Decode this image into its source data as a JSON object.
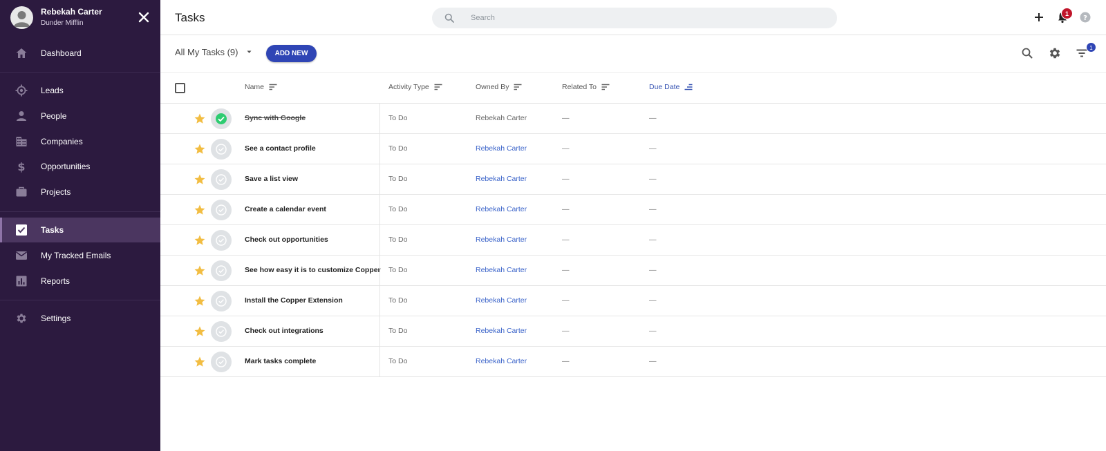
{
  "user": {
    "name": "Rebekah Carter",
    "company": "Dunder Mifflin"
  },
  "nav": {
    "dashboard": "Dashboard",
    "leads": "Leads",
    "people": "People",
    "companies": "Companies",
    "opportunities": "Opportunities",
    "projects": "Projects",
    "tasks": "Tasks",
    "tracked_emails": "My Tracked Emails",
    "reports": "Reports",
    "settings": "Settings"
  },
  "header": {
    "title": "Tasks",
    "search_placeholder": "Search",
    "notification_count": "1"
  },
  "toolbar": {
    "view_label": "All My Tasks (9)",
    "add_new": "ADD NEW",
    "filter_count": "1"
  },
  "columns": {
    "name": "Name",
    "activity_type": "Activity Type",
    "owned_by": "Owned By",
    "related_to": "Related To",
    "due_date": "Due Date"
  },
  "rows": [
    {
      "name": "Sync with Google",
      "type": "To Do",
      "owner": "Rebekah Carter",
      "related": "—",
      "due": "—",
      "completed": true
    },
    {
      "name": "See a contact profile",
      "type": "To Do",
      "owner": "Rebekah Carter",
      "related": "—",
      "due": "—",
      "completed": false
    },
    {
      "name": "Save a list view",
      "type": "To Do",
      "owner": "Rebekah Carter",
      "related": "—",
      "due": "—",
      "completed": false
    },
    {
      "name": "Create a calendar event",
      "type": "To Do",
      "owner": "Rebekah Carter",
      "related": "—",
      "due": "—",
      "completed": false
    },
    {
      "name": "Check out opportunities",
      "type": "To Do",
      "owner": "Rebekah Carter",
      "related": "—",
      "due": "—",
      "completed": false
    },
    {
      "name": "See how easy it is to customize Copper",
      "type": "To Do",
      "owner": "Rebekah Carter",
      "related": "—",
      "due": "—",
      "completed": false
    },
    {
      "name": "Install the Copper Extension",
      "type": "To Do",
      "owner": "Rebekah Carter",
      "related": "—",
      "due": "—",
      "completed": false
    },
    {
      "name": "Check out integrations",
      "type": "To Do",
      "owner": "Rebekah Carter",
      "related": "—",
      "due": "—",
      "completed": false
    },
    {
      "name": "Mark tasks complete",
      "type": "To Do",
      "owner": "Rebekah Carter",
      "related": "—",
      "due": "—",
      "completed": false
    }
  ],
  "colors": {
    "sidebar": "#2c1a3f",
    "accent": "#2f45b5",
    "star": "#f2bd42",
    "done": "#2ecc71",
    "badge": "#c0152a"
  },
  "icons": {
    "nav": [
      "home-icon",
      "leads-target-icon",
      "person-icon",
      "building-icon",
      "dollar-icon",
      "briefcase-icon",
      "checkbox-icon",
      "mail-icon",
      "bar-chart-icon",
      "gear-icon"
    ]
  }
}
